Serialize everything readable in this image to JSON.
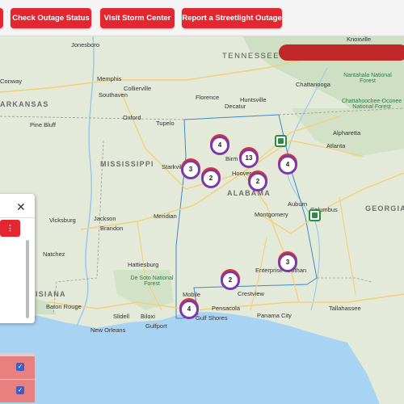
{
  "toolbar": {
    "buttons": [
      {
        "label": ""
      },
      {
        "label": "Check Outage Status"
      },
      {
        "label": "Visit Storm Center"
      },
      {
        "label": "Report a Streetlight Outage"
      }
    ]
  },
  "map": {
    "states": [
      "ARKANSAS",
      "MISSISSIPPI",
      "ALABAMA",
      "GEORGIA",
      "TENNESSEE",
      "ISIANA"
    ],
    "cities": [
      "Jonesboro",
      "Jackson",
      "Conway",
      "Memphis",
      "Collierville",
      "Southaven",
      "Chattanooga",
      "Huntsville",
      "Florence",
      "Decatur",
      "Tupelo",
      "Oxford",
      "Pine Bluff",
      "Starkville",
      "Birm",
      "Hoover",
      "Tuscaloosa",
      "Atlanta",
      "Alpharetta",
      "Marietta",
      "Columbus",
      "Meridian",
      "Montgomery",
      "Auburn",
      "Vicksburg",
      "Brandon",
      "Natchez",
      "Hattiesburg",
      "Enterprise",
      "Dothan",
      "Crestview",
      "Mobile",
      "Pensacola",
      "Gulf Shores",
      "Panama City",
      "Tallahassee",
      "Baton Rouge",
      "New Orleans",
      "Slidell",
      "Biloxi",
      "Gulfport",
      "Greenwood",
      "Laurel",
      "Valdosta",
      "Albany",
      "Macon",
      "Knoxville",
      "Gainesville",
      "Kennesaw",
      "Dalton",
      "Cullman",
      "Gadsden",
      "Anniston",
      "Selma",
      "Clinton",
      "Laplace",
      "Houma",
      "Panama City Beach",
      "Destin",
      "Fort Walton Beach",
      "Navarre",
      "Rome",
      "LaGrange",
      "Opelika",
      "Phenix City",
      "Troy",
      "Ozark",
      "Thomasville",
      "Jasper",
      "Clarksdale",
      "Cleveland",
      "Grenada",
      "Columbus MS",
      "West Point",
      "Southaven MS",
      "Corinth",
      "Muscle Shoals",
      "Athens",
      "Madison",
      "Scottsboro",
      "Fort Payne",
      "Rome GA",
      "Carrollton",
      "Talladega",
      "Alexander City",
      "Prattville",
      "Demopolis",
      "Jackson AL",
      "Brewton",
      "Andalusia",
      "Eufaula",
      "Fort Benning",
      "Warner Robins",
      "Tifton",
      "Moultrie",
      "Bainbridge",
      "Marianna",
      "Crestview FL",
      "Defuniak Springs",
      "Milton",
      "Foley",
      "Daphne",
      "Fairhope",
      "Pascagoula",
      "Ocean Springs",
      "Picayune",
      "Bogalusa",
      "Hammond",
      "McComb",
      "Brookhaven",
      "Monroe",
      "Ruston",
      "El Dorado",
      "Texarkana",
      "Hot Springs",
      "Little Rock"
    ],
    "forests": [
      "Nantahala National Forest",
      "Chattahoochee-Oconee National Forest",
      "De Soto National Forest"
    ],
    "sea_label": "Gulf of Mexico",
    "clusters": [
      {
        "count": "4"
      },
      {
        "count": "3"
      },
      {
        "count": "2"
      },
      {
        "count": "13"
      },
      {
        "count": "4"
      },
      {
        "count": "2"
      },
      {
        "count": "3"
      },
      {
        "count": "2"
      },
      {
        "count": "4"
      }
    ]
  },
  "panel": {
    "close_label": "✕",
    "menu_button_label": "⋮",
    "row1_check": "✓",
    "row2_check": "✓"
  },
  "colors": {
    "accent": "#e3262f",
    "cluster_outer": "#7c3aa8",
    "cluster_ring": "#e0352d",
    "marker_green": "#2e8b45",
    "water": "#a9d3f2"
  }
}
